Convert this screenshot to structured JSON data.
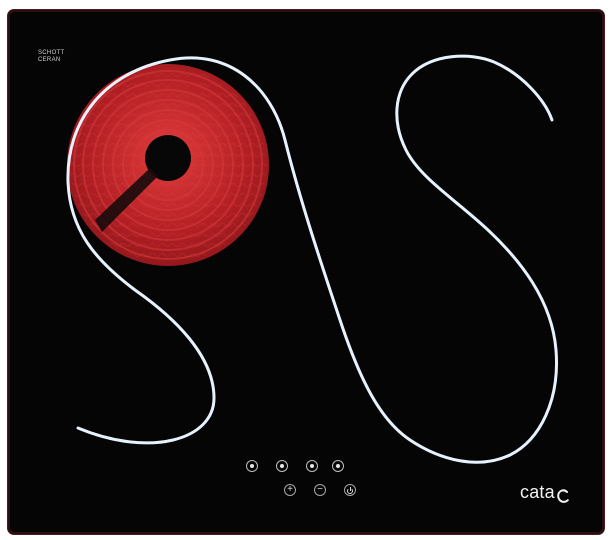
{
  "appliance": {
    "certification": {
      "top_line": "",
      "line1": "SCHOTT",
      "line2": "CERAN"
    },
    "logo": {
      "text": "cata"
    },
    "controls": {
      "zone_selectors": 4,
      "plus_symbol": "+",
      "minus_symbol": "−"
    },
    "colors": {
      "surface": "#050505",
      "heated_zone": "#b21f24",
      "decor_line": "#e7f2ff"
    }
  }
}
